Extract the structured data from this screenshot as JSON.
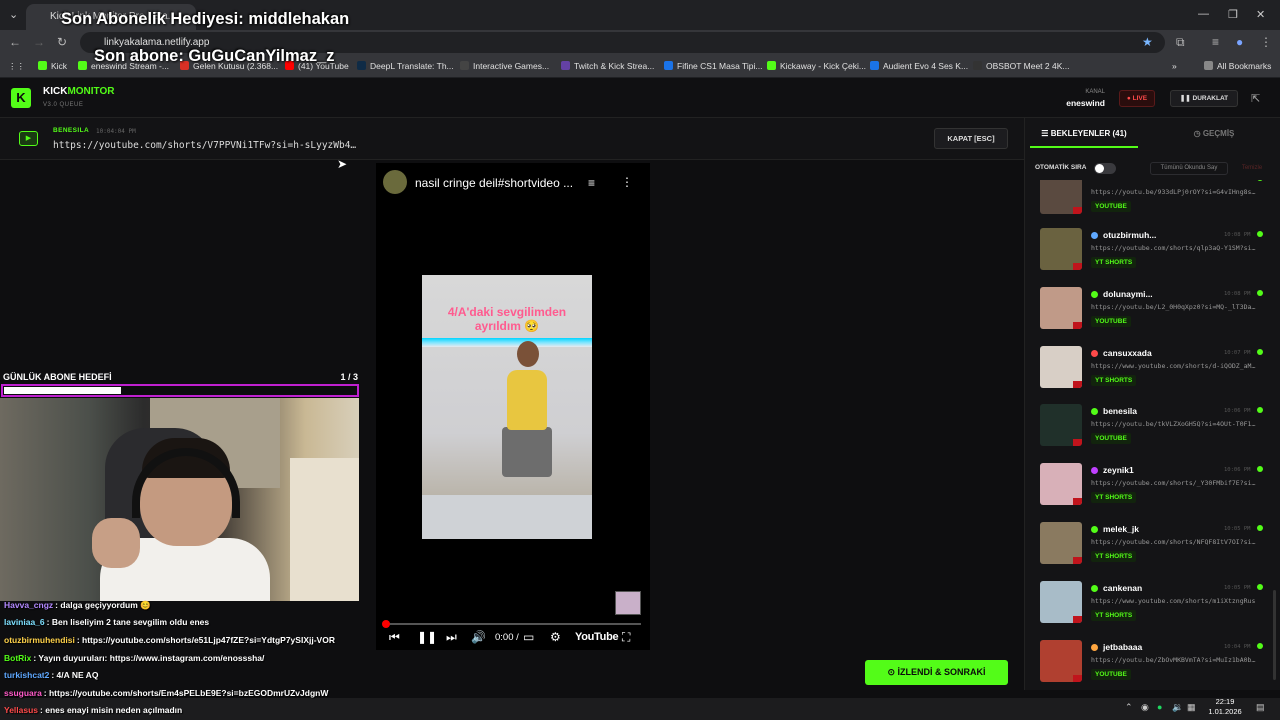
{
  "browser": {
    "tab_title": "Kick Link Monitor Pro | Sta...",
    "url": "linkyakalama.netlify.app",
    "bookmarks": [
      "Kick",
      "eneswind Stream -...",
      "Gelen Kutusu (2.368...",
      "(41) YouTube",
      "DeepL Translate: Th...",
      "Interactive Games...",
      "Twitch & Kick Strea...",
      "Fifine CS1 Masa Tipi...",
      "Kickaway - Kick Çeki...",
      "Audient Evo 4 Ses K...",
      "OBSBOT Meet 2 4K..."
    ],
    "all_bookmarks": "All Bookmarks"
  },
  "overlay": {
    "sub_gift": "Son Abonelik Hediyesi: middlehakan",
    "last_sub": "Son abone: GuGuCanYilmaz_z",
    "goal_label": "GÜNLÜK ABONE HEDEFİ",
    "goal_count": "1 / 3",
    "goal_progress": 0.33
  },
  "app": {
    "logo": "K",
    "brand_a": "KICK",
    "brand_b": "MONITOR",
    "version": "V3.0 QUEUE",
    "kanal_label": "KANAL",
    "kanal_name": "eneswind",
    "live_label": "LIVE",
    "stop_label": "DURAKLAT"
  },
  "now_playing": {
    "user": "BENESILA",
    "time": "10:04:04 PM",
    "url": "https://youtube.com/shorts/V7PPVNi1TFw?si=h-sLyyzWb4…",
    "close_label": "KAPAT [ESC]"
  },
  "video": {
    "title": "nasil cringe deil#shortvideo ...",
    "caption_line1": "4/A'daki sevgilimden",
    "caption_line2": "ayrıldım 🥺",
    "time": "0:00 /",
    "yt_logo": "YouTube"
  },
  "chat": [
    {
      "user": "Havva_cngz",
      "msg": ": dalga geçiyyordum 😊",
      "color": "#b388ff"
    },
    {
      "user": "laviniaa_6",
      "msg": ": Ben liseliyim 2 tane sevgilim oldu enes",
      "color": "#7ee0ff"
    },
    {
      "user": "otuzbirmuhendisi",
      "msg": ": https://youtube.com/shorts/e51Ljp47fZE?si=YdtgP7ySIXjj-VOR",
      "color": "#ffd24a"
    },
    {
      "user": "BotRix",
      "msg": ": Yayın duyuruları: https://www.instagram.com/enosssha/",
      "color": "#53fc18"
    },
    {
      "user": "turkishcat2",
      "msg": ": 4/A NE AQ",
      "color": "#5fa8ff"
    },
    {
      "user": "ssuguara",
      "msg": ": https://youtube.com/shorts/Em4sPELbE9E?si=bzEGODmrUZvJdgnW",
      "color": "#ff5ac8"
    },
    {
      "user": "Yellasus",
      "msg": ": enes enayi misin neden açılmadın",
      "color": "#ff4a4a"
    }
  ],
  "queue": {
    "tab_waiting": "BEKLEYENLER (41)",
    "tab_history": "GEÇMİŞ",
    "auto_label": "OTOMATİK SIRA",
    "mark_all": "Tümünü Okundu Say",
    "clear": "Temizle",
    "items": [
      {
        "user": "",
        "time": "",
        "url": "https://youtu.be/933dLPj0rOY?si=G4vIHng8s…",
        "tag": "YOUTUBE",
        "dot": "#53fc18",
        "thumb": "#5a4a40"
      },
      {
        "user": "otuzbirmuh...",
        "time": "10:08 PM",
        "url": "https://youtube.com/shorts/qlp3aQ-Y1SM?si…",
        "tag": "YT SHORTS",
        "dot": "#5fa8ff",
        "thumb": "#6a6240"
      },
      {
        "user": "dolunaymi...",
        "time": "10:08 PM",
        "url": "https://youtu.be/L2_0H0qXpz0?si=MQ-_lT3Da…",
        "tag": "YOUTUBE",
        "dot": "#53fc18",
        "thumb": "#c09a88"
      },
      {
        "user": "cansuxxada",
        "time": "10:07 PM",
        "url": "https://www.youtube.com/shorts/d-iQODZ_aM…",
        "tag": "YT SHORTS",
        "dot": "#ff4a4a",
        "thumb": "#d8cfc6"
      },
      {
        "user": "benesila",
        "time": "10:06 PM",
        "url": "https://youtu.be/tkVLZXoGH5Q?si=4OUt-T0F1…",
        "tag": "YOUTUBE",
        "dot": "#53fc18",
        "thumb": "#20302a"
      },
      {
        "user": "zeynik1",
        "time": "10:06 PM",
        "url": "https://youtube.com/shorts/_Y30FMbif7E?si…",
        "tag": "YT SHORTS",
        "dot": "#c040ff",
        "thumb": "#d8b0b8"
      },
      {
        "user": "melek_jk",
        "time": "10:05 PM",
        "url": "https://youtube.com/shorts/NFQF8ItV7OI?si…",
        "tag": "YT SHORTS",
        "dot": "#53fc18",
        "thumb": "#8a7a60"
      },
      {
        "user": "cankenan",
        "time": "10:05 PM",
        "url": "https://www.youtube.com/shorts/m1iXtzngRus",
        "tag": "YT SHORTS",
        "dot": "#53fc18",
        "thumb": "#a8bcc8"
      },
      {
        "user": "jetbabaaa",
        "time": "10:04 PM",
        "url": "https://youtu.be/ZbOvMKBVmTA?si=MuIz1bA0b…",
        "tag": "YOUTUBE",
        "dot": "#ffa640",
        "thumb": "#b04030"
      }
    ]
  },
  "done_button": "İZLENDİ & SONRAKİ",
  "clock": {
    "time": "22:19",
    "date": "1.01.2026"
  }
}
